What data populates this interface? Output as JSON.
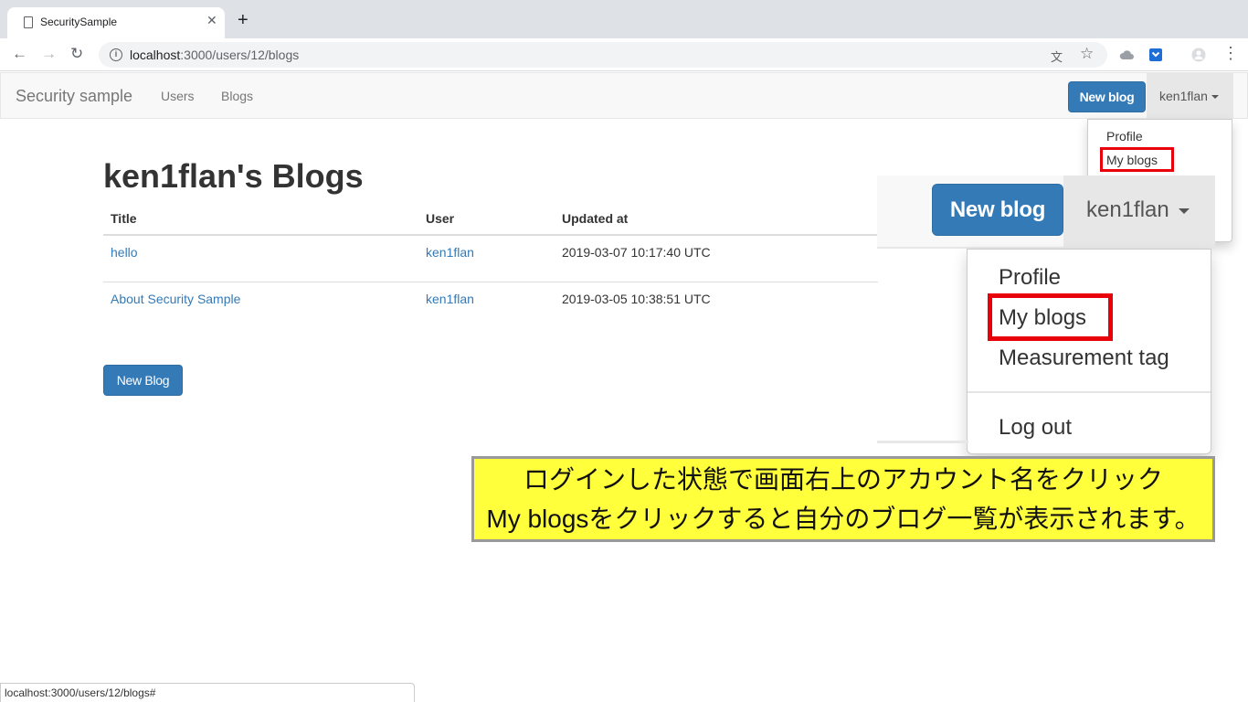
{
  "browser": {
    "tab_title": "SecuritySample",
    "tab_close": "✕",
    "new_tab": "+",
    "back": "←",
    "forward": "→",
    "reload": "↻",
    "url_host": "localhost",
    "url_path": ":3000/users/12/blogs",
    "translate_icon": "文",
    "star_icon": "☆",
    "menu_icon": "⋮"
  },
  "navbar": {
    "brand": "Security sample",
    "links": [
      "Users",
      "Blogs"
    ],
    "new_blog": "New blog",
    "user": "ken1flan"
  },
  "dropdown_small": {
    "items": [
      "Profile",
      "My blogs"
    ]
  },
  "page": {
    "title": "ken1flan's Blogs",
    "columns": [
      "Title",
      "User",
      "Updated at"
    ],
    "rows": [
      {
        "title": "hello",
        "user": "ken1flan",
        "updated_at": "2019-03-07 10:17:40 UTC"
      },
      {
        "title": "About Security Sample",
        "user": "ken1flan",
        "updated_at": "2019-03-05 10:38:51 UTC"
      }
    ],
    "new_blog_button": "New Blog"
  },
  "zoom": {
    "new_blog": "New blog",
    "user": "ken1flan",
    "items": [
      "Profile",
      "My blogs",
      "Measurement tag"
    ],
    "logout": "Log out"
  },
  "callout": {
    "line1": "ログインした状態で画面右上のアカウント名をクリック",
    "line2": "My blogsをクリックすると自分のブログ一覧が表示されます。"
  },
  "status_url": "localhost:3000/users/12/blogs#",
  "colors": {
    "primary": "#337ab7",
    "highlight": "#e8000b",
    "callout_bg": "#ffff3c"
  }
}
